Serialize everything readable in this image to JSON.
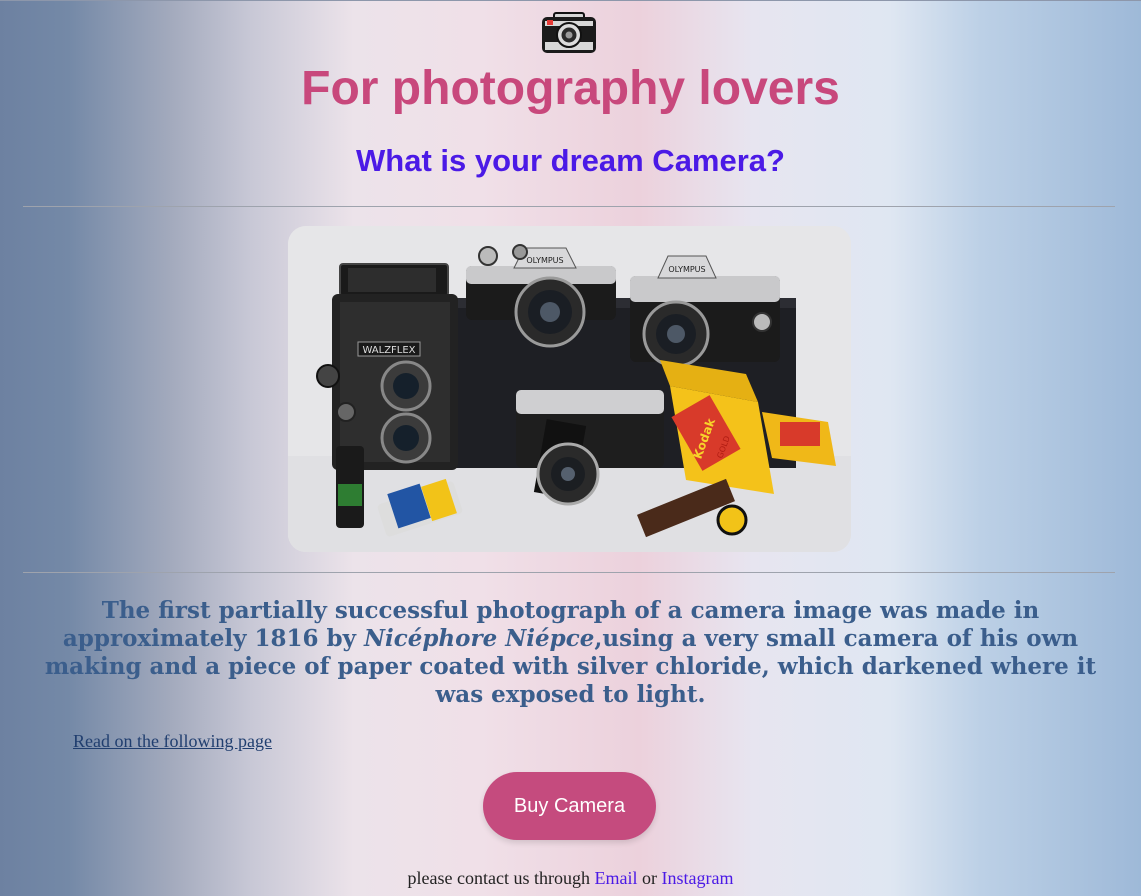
{
  "header": {
    "logo_icon": "camera-icon",
    "title": "For photography lovers",
    "subtitle": "What is your dream Camera?"
  },
  "hero_image": {
    "content": "group of vintage film cameras with film rolls",
    "camera_label_1": "WALZFLEX",
    "camera_label_2": "OLYMPUS",
    "camera_label_3": "OLYMPUS",
    "film_brand": "Kodak",
    "film_name": "GOLD"
  },
  "article": {
    "text_before": "The first partially successful photograph of a camera image was made in approximately 1816 by ",
    "name": "Nicéphore Niépce",
    "text_after": ",using a very small camera of his own making and a piece of paper coated with silver chloride, which darkened where it was exposed to light.",
    "read_more_link": "Read on the following page"
  },
  "cta": {
    "buy_label": "Buy Camera"
  },
  "footer": {
    "contact_prefix": "please contact us through",
    "email_label": "Email",
    "or_text": "or",
    "instagram_label": "Instagram"
  },
  "colors": {
    "title": "#c8487c",
    "subtitle": "#4b1ae6",
    "paragraph": "#3b5e8c",
    "button": "#c54b7e",
    "link": "#4b1ae6"
  }
}
